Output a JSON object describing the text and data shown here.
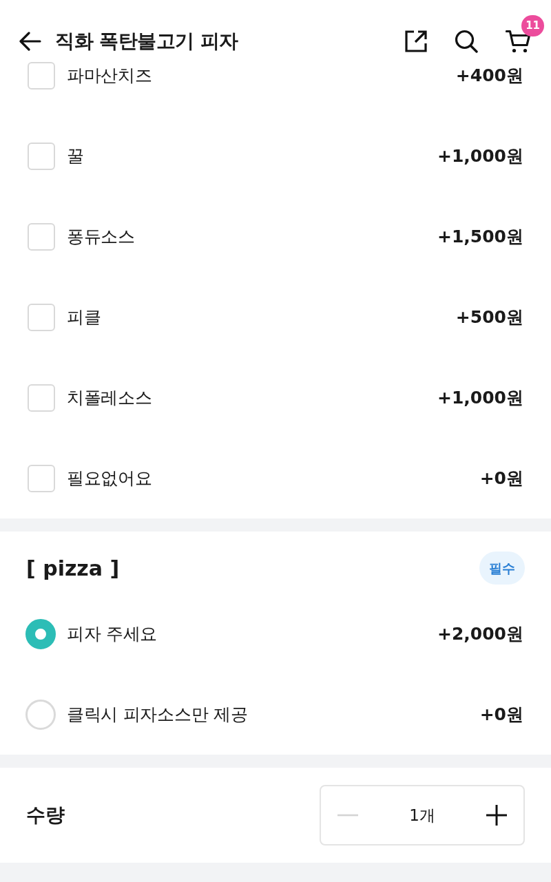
{
  "header": {
    "title": "직화 폭탄불고기 피자",
    "cart_count": "11"
  },
  "topping_options": [
    {
      "label": "파마산치즈",
      "price": "+400원",
      "checked": false
    },
    {
      "label": "꿀",
      "price": "+1,000원",
      "checked": false
    },
    {
      "label": "퐁듀소스",
      "price": "+1,500원",
      "checked": false
    },
    {
      "label": "피클",
      "price": "+500원",
      "checked": false
    },
    {
      "label": "치폴레소스",
      "price": "+1,000원",
      "checked": false
    },
    {
      "label": "필요없어요",
      "price": "+0원",
      "checked": false
    }
  ],
  "pizza_group": {
    "title": "[ pizza ]",
    "badge": "필수",
    "options": [
      {
        "label": "피자 주세요",
        "price": "+2,000원",
        "selected": true
      },
      {
        "label": "클릭시 피자소스만 제공",
        "price": "+0원",
        "selected": false
      }
    ]
  },
  "quantity": {
    "label": "수량",
    "value": "1개",
    "decrease_disabled": true
  }
}
